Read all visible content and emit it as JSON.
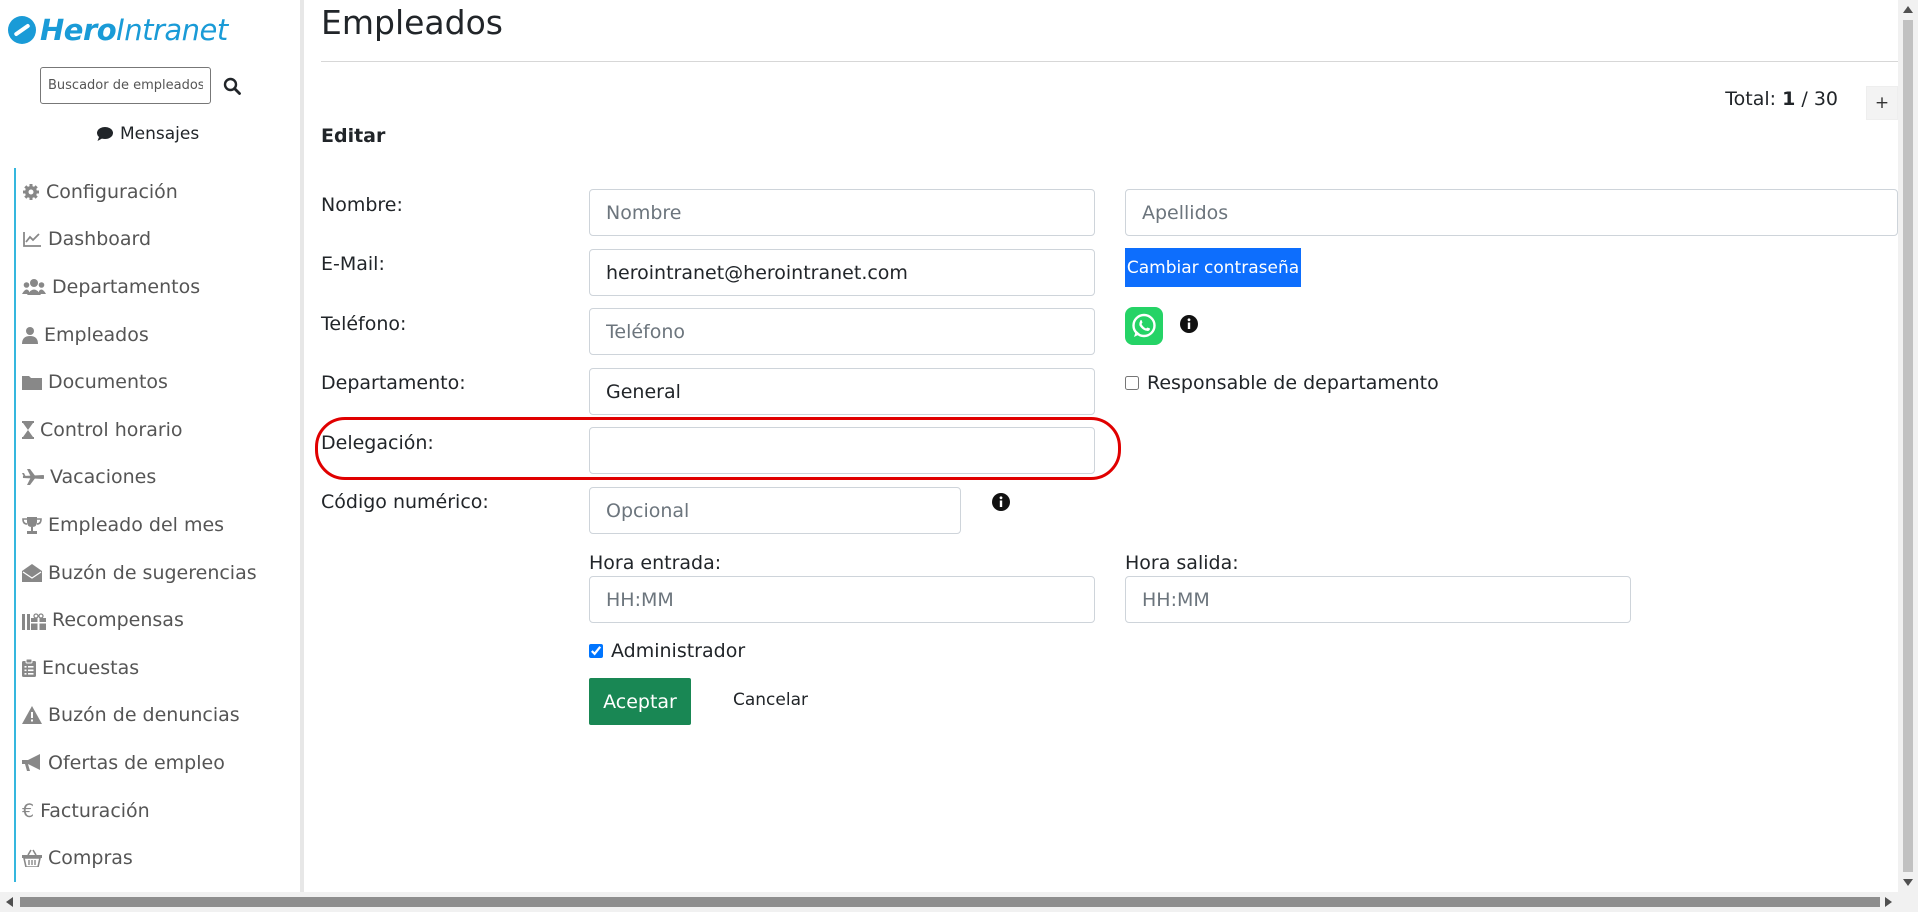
{
  "brand": {
    "hero": "Hero",
    "intranet": "Intranet"
  },
  "search": {
    "placeholder": "Buscador de empleados..."
  },
  "messages": {
    "label": "Mensajes"
  },
  "menu": {
    "items": [
      {
        "label": "Configuración",
        "icon": "gear-icon"
      },
      {
        "label": "Dashboard",
        "icon": "chart-line-icon"
      },
      {
        "label": "Departamentos",
        "icon": "users-icon"
      },
      {
        "label": "Empleados",
        "icon": "user-icon"
      },
      {
        "label": "Documentos",
        "icon": "folder-icon"
      },
      {
        "label": "Control horario",
        "icon": "hourglass-icon"
      },
      {
        "label": "Vacaciones",
        "icon": "plane-icon"
      },
      {
        "label": "Empleado del mes",
        "icon": "trophy-icon"
      },
      {
        "label": "Buzón de sugerencias",
        "icon": "envelope-open-icon"
      },
      {
        "label": "Recompensas",
        "icon": "gifts-icon"
      },
      {
        "label": "Encuestas",
        "icon": "clipboard-list-icon"
      },
      {
        "label": "Buzón de denuncias",
        "icon": "warning-icon"
      },
      {
        "label": "Ofertas de empleo",
        "icon": "megaphone-icon"
      },
      {
        "label": "Facturación",
        "icon": "euro-icon"
      },
      {
        "label": "Compras",
        "icon": "basket-icon"
      }
    ]
  },
  "page": {
    "title": "Empleados",
    "total_label": "Total:",
    "total_current": "1",
    "total_separator": "/",
    "total_max": "30",
    "add_label": "+",
    "section_title": "Editar"
  },
  "form": {
    "nombre_label": "Nombre:",
    "nombre_placeholder": "Nombre",
    "apellidos_placeholder": "Apellidos",
    "email_label": "E-Mail:",
    "email_value": "herointranet@herointranet.com",
    "change_password_label": "Cambiar contraseña",
    "telefono_label": "Teléfono:",
    "telefono_placeholder": "Teléfono",
    "departamento_label": "Departamento:",
    "departamento_value": "General",
    "responsable_label": "Responsable de departamento",
    "responsable_checked": false,
    "delegacion_label": "Delegación:",
    "delegacion_value": "",
    "codigo_label": "Código numérico:",
    "codigo_placeholder": "Opcional",
    "hora_entrada_label": "Hora entrada:",
    "hora_entrada_placeholder": "HH:MM",
    "hora_salida_label": "Hora salida:",
    "hora_salida_placeholder": "HH:MM",
    "administrador_label": "Administrador",
    "administrador_checked": true,
    "accept_label": "Aceptar",
    "cancel_label": "Cancelar"
  },
  "colors": {
    "brand": "#1a9bd7",
    "menu_accent": "#35b7de",
    "primary_button": "#0d6efd",
    "accept_button": "#198754",
    "whatsapp": "#25d366",
    "highlight": "#e00000"
  }
}
